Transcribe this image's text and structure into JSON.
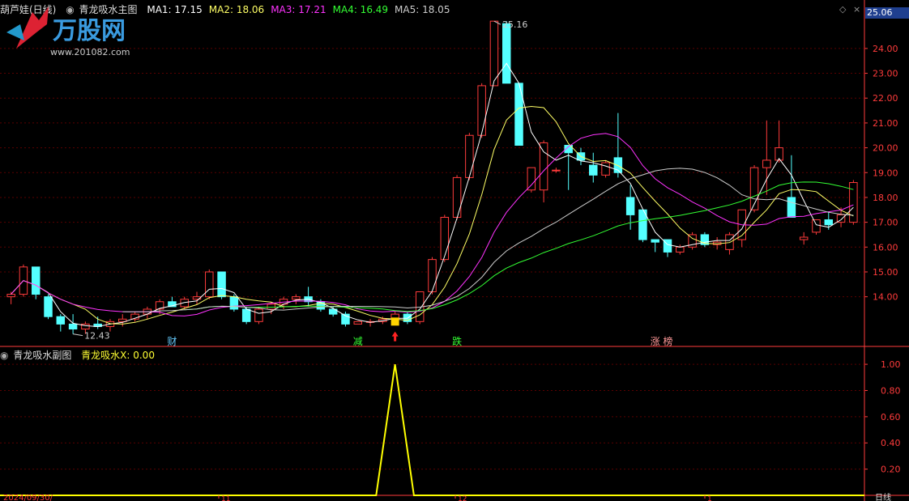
{
  "main_header": {
    "stock_name": "葫芦娃(日线)",
    "indicator_name": "青龙吸水主图",
    "ma": [
      {
        "label": "MA1: 17.15",
        "color": "#ffffff"
      },
      {
        "label": "MA2: 18.06",
        "color": "#ffff66"
      },
      {
        "label": "MA3: 17.21",
        "color": "#ff33ff"
      },
      {
        "label": "MA4: 16.49",
        "color": "#33ff33"
      },
      {
        "label": "MA5: 18.05",
        "color": "#cccccc"
      }
    ]
  },
  "sub_header": {
    "indicator_name": "青龙吸水副图",
    "value_label": "青龙吸水X: 0.00"
  },
  "current_price_tag": "25.06",
  "high_label": "25.16",
  "low_label": "12.43",
  "main_axis_ticks": [
    "24.00",
    "23.00",
    "22.00",
    "21.00",
    "20.00",
    "19.00",
    "18.00",
    "17.00",
    "16.00",
    "15.00",
    "14.00"
  ],
  "sub_axis_ticks": [
    "1.00",
    "0.80",
    "0.60",
    "0.40",
    "0.20"
  ],
  "events": [
    {
      "text": "财",
      "color": "#66ccff"
    },
    {
      "text": "减",
      "color": "#33ff33"
    },
    {
      "text": "跌",
      "color": "#33ff33"
    },
    {
      "text": "涨 榜",
      "color": "#ff9999"
    }
  ],
  "date_label": "2024/09/30/",
  "date_ticks": [
    "11",
    "12",
    "1"
  ],
  "period_label": "日线",
  "watermark": {
    "brand": "万股网",
    "url": "www.201082.com"
  },
  "colors": {
    "up": "#ff3b3b",
    "down": "#54ffff",
    "grid": "#5a0000",
    "axis": "#ff3b3b",
    "signal": "#ffff00"
  },
  "chart_data": {
    "type": "candlestick",
    "ylim": [
      12.0,
      25.3
    ],
    "candles": [
      [
        14.0,
        14.2,
        13.7,
        14.1
      ],
      [
        14.1,
        15.3,
        14.0,
        15.2
      ],
      [
        15.2,
        15.2,
        13.9,
        14.1
      ],
      [
        14.0,
        14.1,
        13.1,
        13.2
      ],
      [
        13.2,
        13.3,
        12.6,
        12.9
      ],
      [
        12.9,
        13.3,
        12.5,
        12.7
      ],
      [
        12.7,
        13.0,
        12.5,
        12.9
      ],
      [
        12.9,
        13.2,
        12.7,
        12.8
      ],
      [
        12.8,
        13.1,
        12.6,
        13.0
      ],
      [
        13.0,
        13.3,
        12.8,
        13.1
      ],
      [
        13.1,
        13.4,
        13.0,
        13.3
      ],
      [
        13.3,
        13.6,
        13.1,
        13.5
      ],
      [
        13.5,
        13.9,
        13.3,
        13.8
      ],
      [
        13.8,
        14.0,
        13.6,
        13.6
      ],
      [
        13.6,
        14.0,
        13.5,
        13.9
      ],
      [
        13.9,
        14.2,
        13.7,
        14.0
      ],
      [
        14.0,
        15.1,
        13.9,
        15.0
      ],
      [
        15.0,
        15.0,
        13.9,
        14.0
      ],
      [
        14.0,
        14.1,
        13.4,
        13.5
      ],
      [
        13.5,
        13.6,
        12.9,
        13.0
      ],
      [
        13.0,
        13.6,
        12.9,
        13.5
      ],
      [
        13.5,
        13.8,
        13.3,
        13.7
      ],
      [
        13.7,
        14.0,
        13.5,
        13.9
      ],
      [
        13.9,
        14.1,
        13.7,
        14.0
      ],
      [
        14.0,
        14.4,
        13.6,
        13.8
      ],
      [
        13.8,
        13.9,
        13.4,
        13.5
      ],
      [
        13.5,
        13.6,
        13.2,
        13.3
      ],
      [
        13.3,
        13.4,
        12.8,
        12.9
      ],
      [
        12.9,
        13.0,
        12.9,
        13.0
      ],
      [
        13.0,
        13.1,
        12.8,
        13.0
      ],
      [
        13.0,
        13.2,
        12.9,
        13.1
      ],
      [
        13.1,
        13.4,
        13.0,
        13.3
      ],
      [
        13.3,
        13.4,
        12.9,
        13.0
      ],
      [
        13.0,
        14.2,
        12.9,
        14.2
      ],
      [
        14.2,
        15.6,
        14.1,
        15.5
      ],
      [
        15.5,
        17.3,
        15.4,
        17.2
      ],
      [
        17.2,
        18.9,
        17.1,
        18.8
      ],
      [
        18.8,
        20.6,
        18.7,
        20.5
      ],
      [
        20.5,
        22.6,
        20.4,
        22.5
      ],
      [
        22.5,
        25.1,
        23.8,
        25.1
      ],
      [
        25.0,
        25.1,
        22.6,
        22.6
      ],
      [
        22.6,
        22.6,
        20.1,
        20.1
      ],
      [
        18.3,
        19.2,
        18.2,
        19.2
      ],
      [
        18.3,
        20.3,
        17.8,
        20.2
      ],
      [
        19.1,
        19.2,
        19.0,
        19.1
      ],
      [
        20.1,
        20.1,
        18.3,
        19.8
      ],
      [
        19.8,
        20.0,
        19.3,
        19.5
      ],
      [
        19.3,
        19.8,
        18.6,
        18.9
      ],
      [
        18.9,
        19.5,
        18.8,
        19.4
      ],
      [
        19.6,
        21.4,
        18.8,
        19.0
      ],
      [
        18.0,
        18.5,
        16.7,
        17.3
      ],
      [
        17.5,
        17.5,
        16.2,
        16.3
      ],
      [
        16.3,
        16.3,
        15.8,
        16.2
      ],
      [
        16.3,
        16.3,
        15.6,
        15.8
      ],
      [
        15.8,
        16.1,
        15.7,
        16.0
      ],
      [
        16.0,
        16.6,
        15.9,
        16.5
      ],
      [
        16.5,
        16.6,
        16.0,
        16.1
      ],
      [
        16.1,
        16.4,
        15.9,
        16.2
      ],
      [
        15.9,
        16.6,
        15.7,
        16.5
      ],
      [
        16.3,
        17.5,
        16.0,
        17.5
      ],
      [
        17.5,
        19.3,
        17.4,
        19.2
      ],
      [
        19.2,
        21.1,
        18.1,
        19.5
      ],
      [
        19.5,
        21.1,
        19.4,
        20.0
      ],
      [
        18.0,
        19.7,
        17.2,
        17.2
      ],
      [
        16.3,
        16.6,
        16.1,
        16.4
      ],
      [
        16.6,
        17.1,
        16.5,
        17.1
      ],
      [
        17.1,
        17.4,
        16.7,
        16.9
      ],
      [
        17.0,
        17.6,
        16.8,
        17.3
      ],
      [
        17.0,
        18.7,
        16.9,
        18.6
      ]
    ],
    "signal": {
      "name": "青龙吸水X",
      "x": [
        0,
        30,
        31,
        32,
        68
      ],
      "y": [
        0,
        0,
        1,
        0,
        0
      ],
      "ylim": [
        0,
        1.05
      ]
    }
  }
}
